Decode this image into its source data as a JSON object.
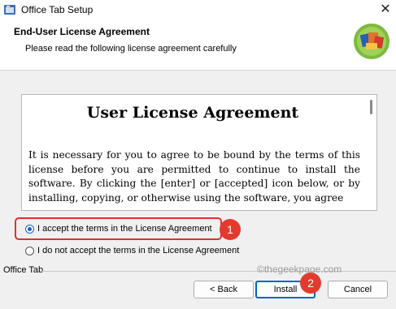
{
  "window": {
    "title": "Office Tab Setup"
  },
  "header": {
    "title": "End-User License Agreement",
    "subtitle": "Please read the following license agreement carefully"
  },
  "license": {
    "heading": "User License Agreement",
    "body": "It is necessary for you to agree to be bound by the terms of this license before you are permitted to continue to install the software. By clicking the [enter] or [accepted] icon below, or by installing, copying, or otherwise using the software, you agree"
  },
  "options": {
    "accept_label": "I accept the terms in the License Agreement",
    "decline_label": "I do not accept the terms in the License Agreement",
    "selected": "accept"
  },
  "footer": {
    "group_label": "Office Tab",
    "watermark": "©thegeekpage.com"
  },
  "buttons": {
    "back": "< Back",
    "install": "Install",
    "cancel": "Cancel"
  },
  "annotations": {
    "step1": "1",
    "step2": "2"
  },
  "colors": {
    "annotation": "#e23b2e",
    "accent": "#0067c0"
  }
}
